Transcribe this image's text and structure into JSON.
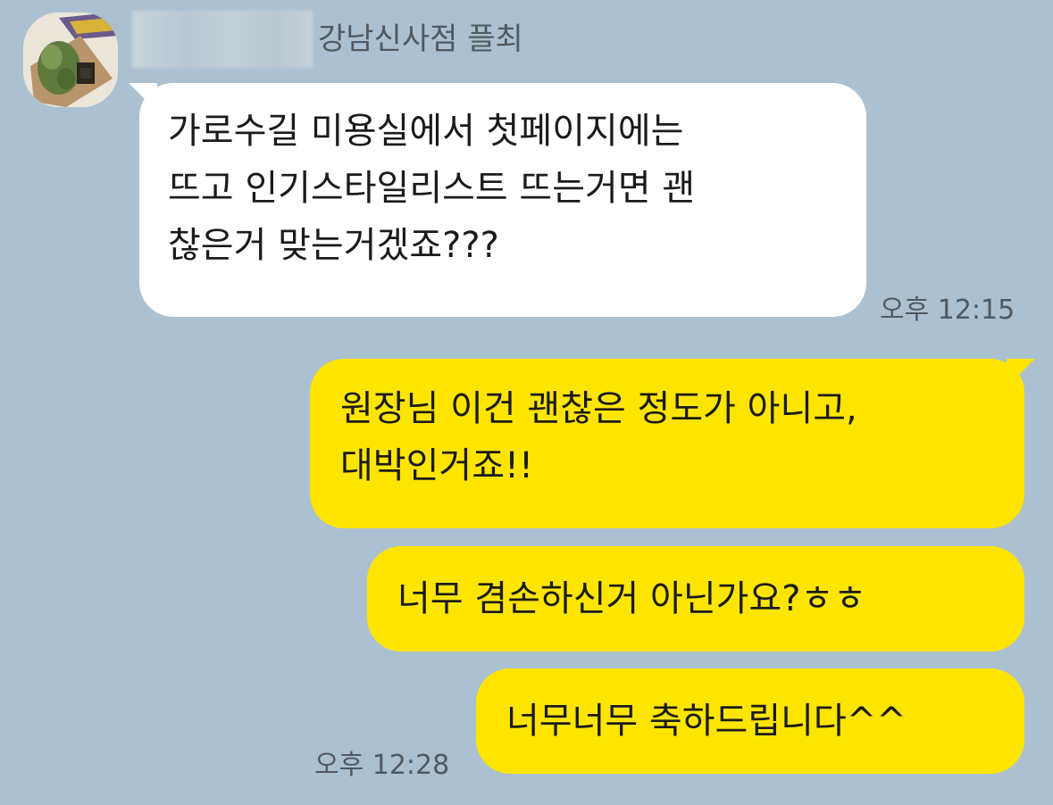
{
  "chat": {
    "sender_name": "강남신사점 플최",
    "received": {
      "lines": [
        "가로수길 미용실에서 첫페이지에는",
        "뜨고 인기스타일리스트 뜨는거면 괜",
        "찮은거 맞는거겠죠???"
      ],
      "time": "오후 12:15"
    },
    "sent": [
      {
        "lines": [
          "원장님 이건 괜찮은 정도가 아니고,",
          "대박인거죠!!"
        ]
      },
      {
        "lines": [
          "너무 겸손하신거 아닌가요?ㅎㅎ"
        ]
      },
      {
        "lines": [
          "너무너무 축하드립니다^^"
        ]
      }
    ],
    "sent_time": "오후 12:28"
  },
  "colors": {
    "background": "#abc1d1",
    "received_bubble": "#ffffff",
    "sent_bubble": "#fee500"
  },
  "icons": {
    "avatar": "profile-photo"
  }
}
